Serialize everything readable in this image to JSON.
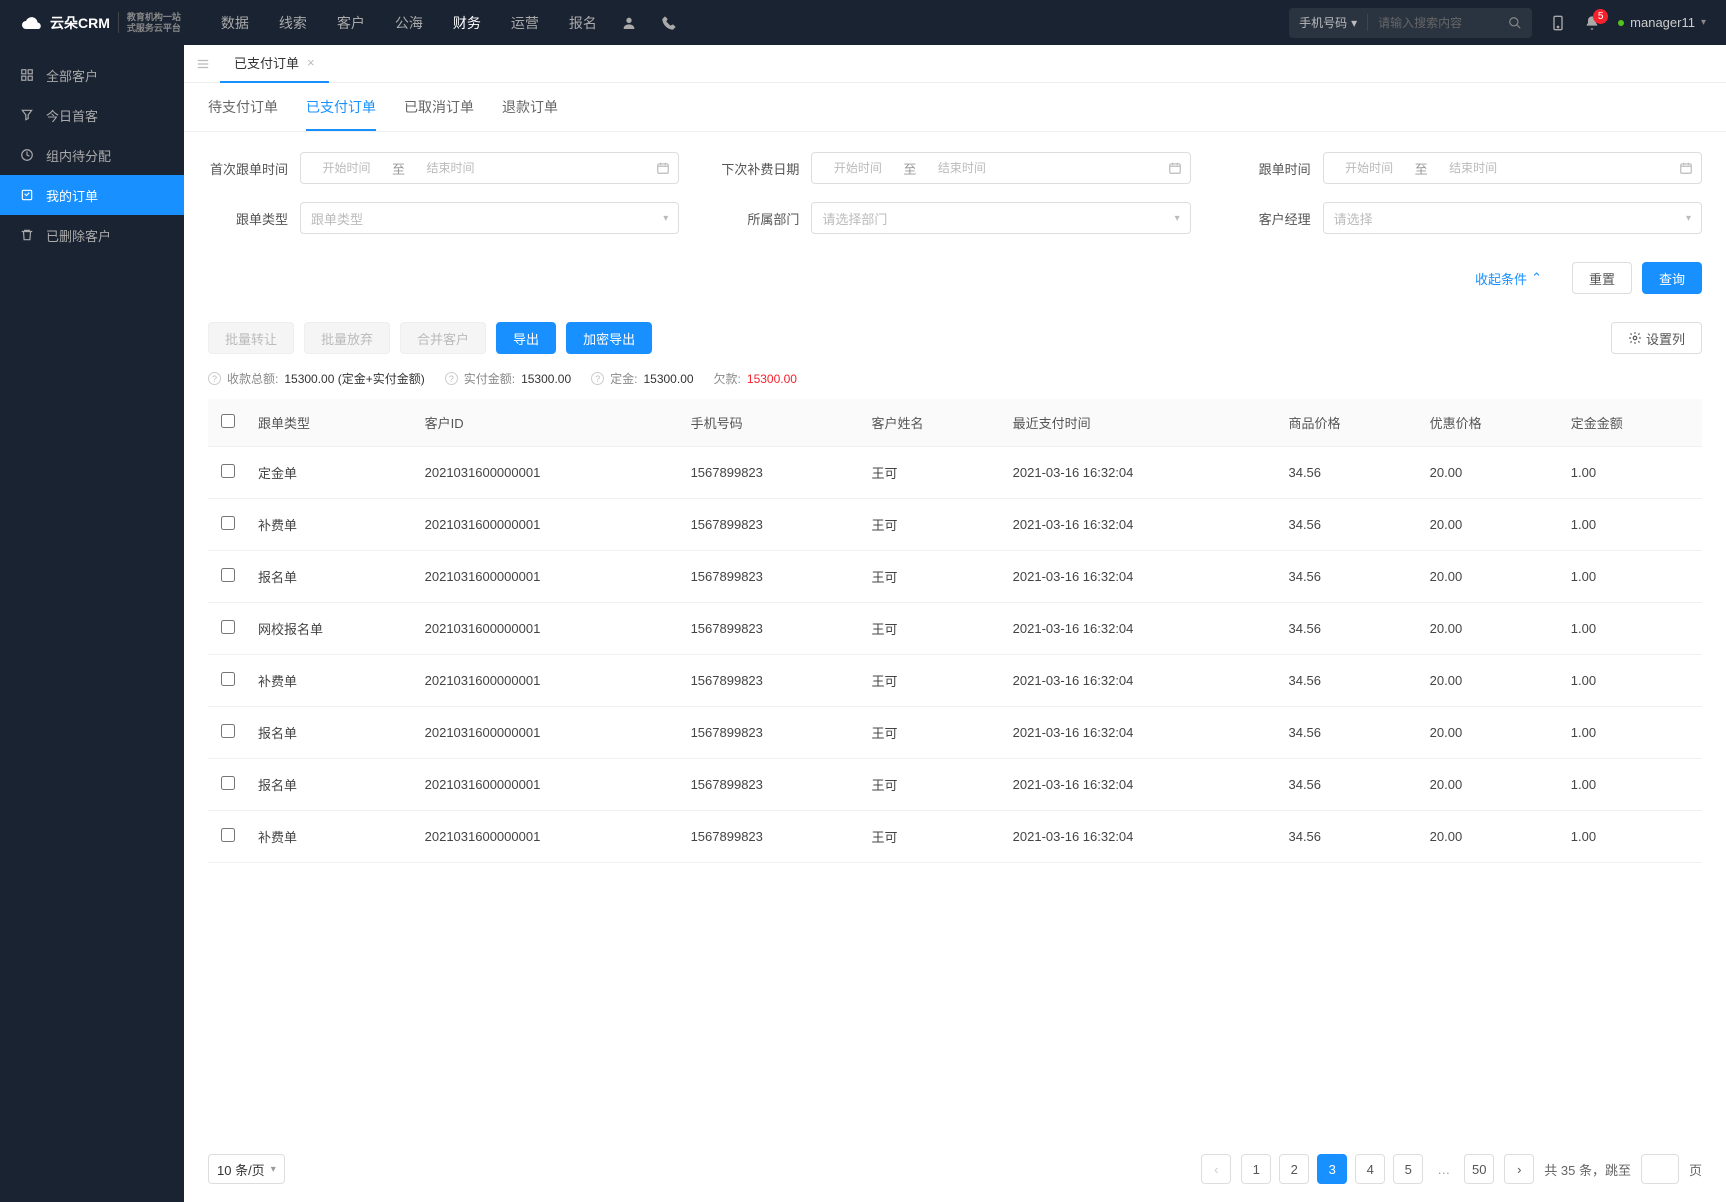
{
  "brand": {
    "name": "云朵CRM",
    "sub1": "教育机构一站",
    "sub2": "式服务云平台"
  },
  "topnav": [
    "数据",
    "线索",
    "客户",
    "公海",
    "财务",
    "运营",
    "报名"
  ],
  "topnav_active": 4,
  "search": {
    "type": "手机号码",
    "placeholder": "请输入搜索内容"
  },
  "notification_count": "5",
  "user": {
    "name": "manager11"
  },
  "sidebar": [
    {
      "label": "全部客户"
    },
    {
      "label": "今日首客"
    },
    {
      "label": "组内待分配"
    },
    {
      "label": "我的订单"
    },
    {
      "label": "已删除客户"
    }
  ],
  "sidebar_active": 3,
  "tab": {
    "label": "已支付订单"
  },
  "subtabs": [
    "待支付订单",
    "已支付订单",
    "已取消订单",
    "退款订单"
  ],
  "subtabs_active": 1,
  "filters": {
    "first_follow": {
      "label": "首次跟单时间",
      "start_ph": "开始时间",
      "sep": "至",
      "end_ph": "结束时间"
    },
    "next_renew": {
      "label": "下次补费日期",
      "start_ph": "开始时间",
      "sep": "至",
      "end_ph": "结束时间"
    },
    "follow_time": {
      "label": "跟单时间",
      "start_ph": "开始时间",
      "sep": "至",
      "end_ph": "结束时间"
    },
    "follow_type": {
      "label": "跟单类型",
      "ph": "跟单类型"
    },
    "department": {
      "label": "所属部门",
      "ph": "请选择部门"
    },
    "account_mgr": {
      "label": "客户经理",
      "ph": "请选择"
    },
    "collapse": "收起条件",
    "reset": "重置",
    "query": "查询"
  },
  "actions": {
    "batch_transfer": "批量转让",
    "batch_abandon": "批量放弃",
    "merge_customer": "合并客户",
    "export": "导出",
    "encrypted_export": "加密导出",
    "set_columns": "设置列"
  },
  "summary": {
    "total_label": "收款总额:",
    "total_value": "15300.00 (定金+实付金额)",
    "paid_label": "实付金额:",
    "paid_value": "15300.00",
    "deposit_label": "定金:",
    "deposit_value": "15300.00",
    "debt_label": "欠款:",
    "debt_value": "15300.00"
  },
  "table": {
    "columns": [
      "跟单类型",
      "客户ID",
      "手机号码",
      "客户姓名",
      "最近支付时间",
      "商品价格",
      "优惠价格",
      "定金金额"
    ],
    "rows": [
      [
        "定金单",
        "2021031600000001",
        "1567899823",
        "王可",
        "2021-03-16 16:32:04",
        "34.56",
        "20.00",
        "1.00"
      ],
      [
        "补费单",
        "2021031600000001",
        "1567899823",
        "王可",
        "2021-03-16 16:32:04",
        "34.56",
        "20.00",
        "1.00"
      ],
      [
        "报名单",
        "2021031600000001",
        "1567899823",
        "王可",
        "2021-03-16 16:32:04",
        "34.56",
        "20.00",
        "1.00"
      ],
      [
        "网校报名单",
        "2021031600000001",
        "1567899823",
        "王可",
        "2021-03-16 16:32:04",
        "34.56",
        "20.00",
        "1.00"
      ],
      [
        "补费单",
        "2021031600000001",
        "1567899823",
        "王可",
        "2021-03-16 16:32:04",
        "34.56",
        "20.00",
        "1.00"
      ],
      [
        "报名单",
        "2021031600000001",
        "1567899823",
        "王可",
        "2021-03-16 16:32:04",
        "34.56",
        "20.00",
        "1.00"
      ],
      [
        "报名单",
        "2021031600000001",
        "1567899823",
        "王可",
        "2021-03-16 16:32:04",
        "34.56",
        "20.00",
        "1.00"
      ],
      [
        "补费单",
        "2021031600000001",
        "1567899823",
        "王可",
        "2021-03-16 16:32:04",
        "34.56",
        "20.00",
        "1.00"
      ]
    ]
  },
  "pagination": {
    "page_size": "10 条/页",
    "pages": [
      "1",
      "2",
      "3",
      "4",
      "5"
    ],
    "last_page": "50",
    "active": 2,
    "total_prefix": "共 ",
    "total": "35",
    "total_suffix": " 条，跳至",
    "jump_suffix": "页"
  }
}
